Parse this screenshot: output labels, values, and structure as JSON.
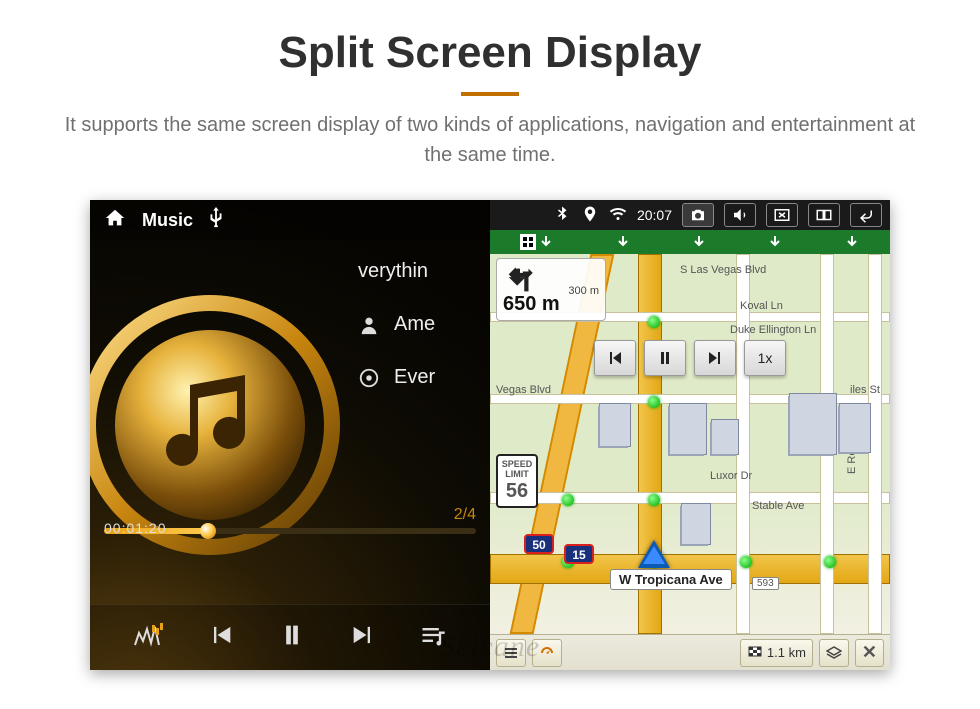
{
  "header": {
    "title": "Split Screen Display",
    "subtitle": "It supports the same screen display of two kinds of applications, navigation and entertainment at the same time."
  },
  "music": {
    "app_label": "Music",
    "track_title": "verythin",
    "artist": "Ame",
    "album": "Ever",
    "track_index": "2/4",
    "elapsed": "00:01:20"
  },
  "status_bar": {
    "time": "20:07"
  },
  "nav": {
    "turn": {
      "dist_ahead": "300 m",
      "dist_now": "650 m"
    },
    "speed_limit": {
      "label1": "SPEED",
      "label2": "LIMIT",
      "value": "56"
    },
    "sim_speed": "1x",
    "route_shield_a": "50",
    "route_shield_b": "15",
    "current_road": "W Tropicana Ave",
    "pin_num": "593",
    "streets": {
      "vegas": "S Las Vegas Blvd",
      "koval": "Koval Ln",
      "duke": "Duke Ellington Ln",
      "vegas2": "Vegas Blvd",
      "luxor": "Luxor Dr",
      "stable": "Stable Ave",
      "reno": "E Reno Ave",
      "iles": "iles St"
    },
    "bottom": {
      "remaining_km": "1.1 km"
    }
  },
  "watermark": "Seicane"
}
